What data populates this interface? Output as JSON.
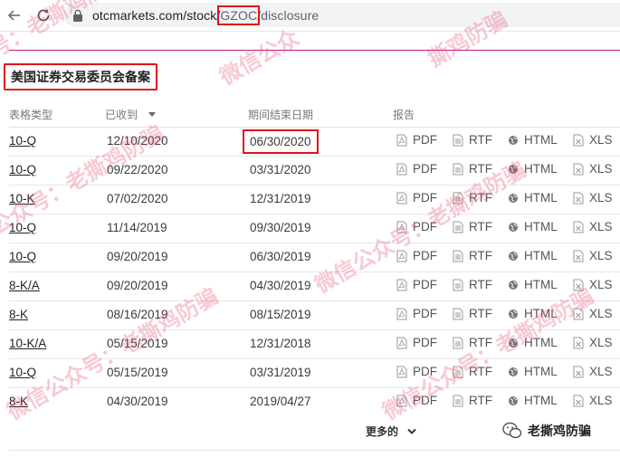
{
  "browser": {
    "url_prefix": "otcmarkets.com/stock/",
    "url_symbol": "GZOC",
    "url_suffix": "/disclosure"
  },
  "section": {
    "title": "美国证券交易委员会备案"
  },
  "table": {
    "headers": {
      "type": "表格类型",
      "received": "已收到",
      "period_end": "期间结束日期",
      "reports": "报告"
    },
    "rows": [
      {
        "type": "10-Q",
        "received": "12/10/2020",
        "period_end": "06/30/2020"
      },
      {
        "type": "10-Q",
        "received": "09/22/2020",
        "period_end": "03/31/2020"
      },
      {
        "type": "10-K",
        "received": "07/02/2020",
        "period_end": "12/31/2019"
      },
      {
        "type": "10-Q",
        "received": "11/14/2019",
        "period_end": "09/30/2019"
      },
      {
        "type": "10-Q",
        "received": "09/20/2019",
        "period_end": "06/30/2019"
      },
      {
        "type": "8-K/A",
        "received": "09/20/2019",
        "period_end": "04/30/2019"
      },
      {
        "type": "8-K",
        "received": "08/16/2019",
        "period_end": "08/15/2019"
      },
      {
        "type": "10-K/A",
        "received": "05/15/2019",
        "period_end": "12/31/2018"
      },
      {
        "type": "10-Q",
        "received": "05/15/2019",
        "period_end": "03/31/2019"
      },
      {
        "type": "8-K",
        "received": "04/30/2019",
        "period_end": "2019/04/27"
      }
    ],
    "report_labels": {
      "pdf": "PDF",
      "rtf": "RTF",
      "html": "HTML",
      "xls": "XLS"
    }
  },
  "more_label": "更多的",
  "brand_label": "老撕鸡防骗",
  "watermark_text": "微信公众号：老撕鸡防骗",
  "colors": {
    "highlight": "#e0141b",
    "divider": "#c2187a"
  },
  "icons": [
    "back-arrow-icon",
    "reload-icon",
    "lock-icon",
    "pdf-file-icon",
    "rtf-file-icon",
    "globe-icon",
    "xls-file-icon",
    "chevron-down-icon",
    "wechat-icon"
  ]
}
